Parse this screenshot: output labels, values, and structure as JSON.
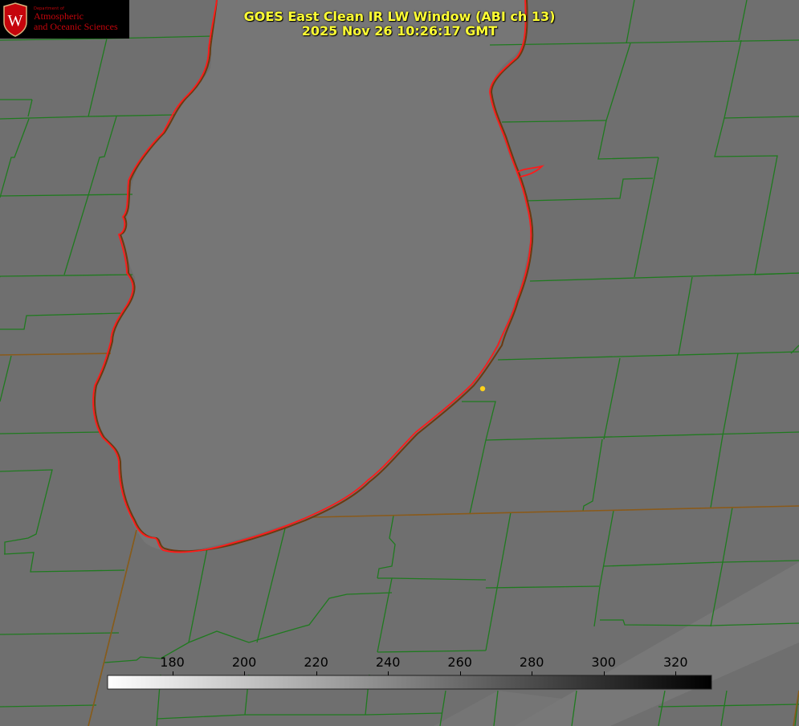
{
  "logo": {
    "department": "Department of",
    "line1": "Atmospheric",
    "line2": "and Oceanic Sciences",
    "crest_letter": "W"
  },
  "title": {
    "line1": "GOES East Clean IR LW Window (ABI ch 13)",
    "line2": "2025 Nov 26 10:26:17 GMT"
  },
  "colorbar": {
    "range": [
      162,
      330
    ],
    "ticks": [
      "180",
      "200",
      "220",
      "240",
      "260",
      "280",
      "300",
      "320"
    ],
    "tick_values": [
      180,
      200,
      220,
      240,
      260,
      280,
      300,
      320
    ],
    "colors": [
      "#ffffff",
      "#000000"
    ]
  },
  "colors": {
    "land": "#6f6f6f",
    "lake": "#767676",
    "county_lines": "#1f7a1f",
    "shoreline": "#ff1a1a",
    "title_text": "#ffff33",
    "marker": "#ffd21a"
  }
}
